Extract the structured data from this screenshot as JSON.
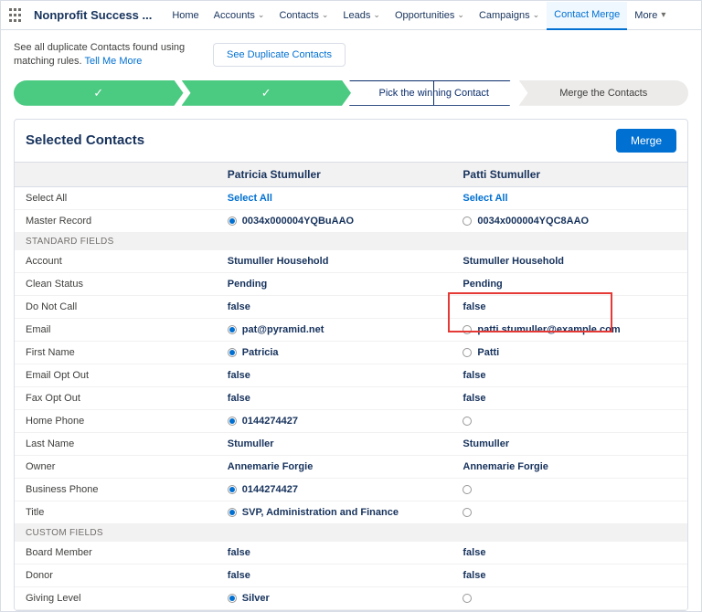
{
  "app_name": "Nonprofit Success ...",
  "nav": [
    "Home",
    "Accounts",
    "Contacts",
    "Leads",
    "Opportunities",
    "Campaigns",
    "Contact Merge",
    "More"
  ],
  "subheader": {
    "text": "See all duplicate Contacts found using matching rules.",
    "link": "Tell Me More",
    "button": "See Duplicate Contacts"
  },
  "steps": {
    "step3": "Pick the winning Contact",
    "step4": "Merge the Contacts"
  },
  "panel": {
    "title": "Selected Contacts",
    "merge_button": "Merge"
  },
  "columns": {
    "a": "Patricia Stumuller",
    "b": "Patti Stumuller",
    "select_all": "Select All"
  },
  "labels": {
    "select_all": "Select All",
    "master_record": "Master Record",
    "standard_fields": "STANDARD FIELDS",
    "custom_fields": "CUSTOM FIELDS",
    "account": "Account",
    "clean_status": "Clean Status",
    "do_not_call": "Do Not Call",
    "email": "Email",
    "first_name": "First Name",
    "email_opt_out": "Email Opt Out",
    "fax_opt_out": "Fax Opt Out",
    "home_phone": "Home Phone",
    "last_name": "Last Name",
    "owner": "Owner",
    "business_phone": "Business Phone",
    "title": "Title",
    "board_member": "Board Member",
    "donor": "Donor",
    "giving_level": "Giving Level"
  },
  "a": {
    "master_record": "0034x000004YQBuAAO",
    "account": "Stumuller Household",
    "clean_status": "Pending",
    "do_not_call": "false",
    "email": "pat@pyramid.net",
    "first_name": "Patricia",
    "email_opt_out": "false",
    "fax_opt_out": "false",
    "home_phone": "0144274427",
    "last_name": "Stumuller",
    "owner": "Annemarie Forgie",
    "business_phone": "0144274427",
    "title": "SVP, Administration and Finance",
    "board_member": "false",
    "donor": "false",
    "giving_level": "Silver"
  },
  "b": {
    "master_record": "0034x000004YQC8AAO",
    "account": "Stumuller Household",
    "clean_status": "Pending",
    "do_not_call": "false",
    "email": "patti.stumuller@example.com",
    "first_name": "Patti",
    "email_opt_out": "false",
    "fax_opt_out": "false",
    "home_phone": "",
    "last_name": "Stumuller",
    "owner": "Annemarie Forgie",
    "business_phone": "",
    "title": "",
    "board_member": "false",
    "donor": "false",
    "giving_level": ""
  }
}
